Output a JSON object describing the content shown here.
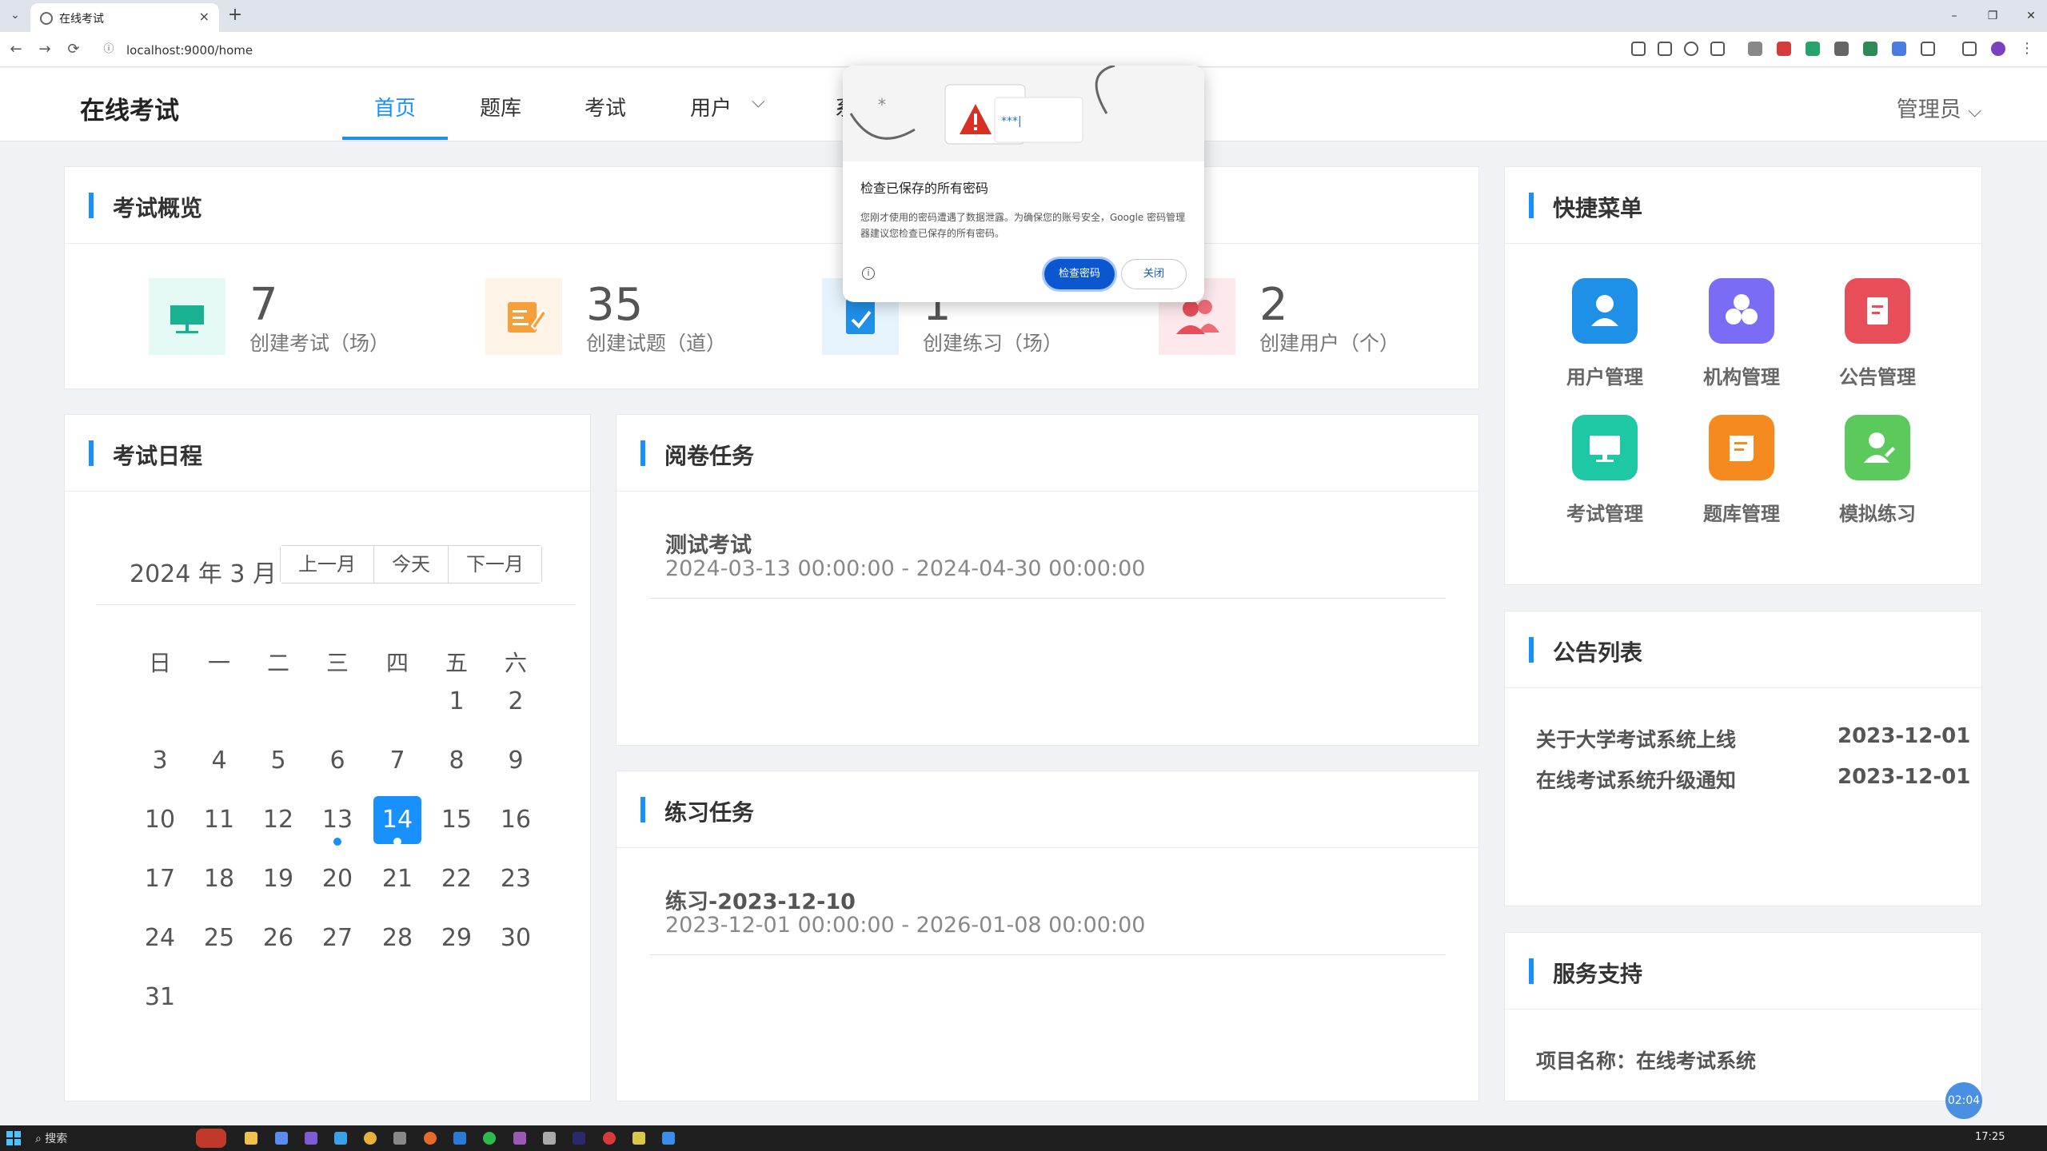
{
  "browser": {
    "tab_title": "在线考试",
    "tab_close": "×",
    "new_tab": "+",
    "url": "localhost:9000/home",
    "back": "←",
    "forward": "→",
    "reload": "⟳",
    "minimize": "–",
    "restore": "❐",
    "close": "✕"
  },
  "header": {
    "logo": "在线考试",
    "menu": [
      "首页",
      "题库",
      "考试",
      "用户",
      "系"
    ],
    "user_dropdown_caret": "⌵",
    "admin": "管理员"
  },
  "overview": {
    "title": "考试概览",
    "stats": [
      {
        "value": "7",
        "label": "创建考试（场）",
        "color": "#19b394",
        "bg": "#e6faf5"
      },
      {
        "value": "35",
        "label": "创建试题（道）",
        "color": "#f7a03b",
        "bg": "#fdf3e7"
      },
      {
        "value": "1",
        "label": "创建练习（场）",
        "color": "#1e90e8",
        "bg": "#e6f3fd"
      },
      {
        "value": "2",
        "label": "创建用户（个）",
        "color": "#e84d5a",
        "bg": "#fde9eb"
      }
    ]
  },
  "calendar": {
    "title": "考试日程",
    "month": "2024 年 3 月",
    "buttons": [
      "上一月",
      "今天",
      "下一月"
    ],
    "weekdays": [
      "日",
      "一",
      "二",
      "三",
      "四",
      "五",
      "六"
    ],
    "days": [
      "1",
      "2",
      "3",
      "4",
      "5",
      "6",
      "7",
      "8",
      "9",
      "10",
      "11",
      "12",
      "13",
      "14",
      "15",
      "16",
      "17",
      "18",
      "19",
      "20",
      "21",
      "22",
      "23",
      "24",
      "25",
      "26",
      "27",
      "28",
      "29",
      "30",
      "31"
    ],
    "first_weekday": 5,
    "today": 14,
    "event_days": [
      13,
      14
    ]
  },
  "review": {
    "title": "阅卷任务",
    "items": [
      {
        "name": "测试考试",
        "range": "2024-03-13 00:00:00 - 2024-04-30 00:00:00"
      }
    ]
  },
  "practice": {
    "title": "练习任务",
    "items": [
      {
        "name": "练习-2023-12-10",
        "range": "2023-12-01 00:00:00 - 2026-01-08 00:00:00"
      }
    ]
  },
  "quick_menu": {
    "title": "快捷菜单",
    "items": [
      {
        "label": "用户管理",
        "color": "#1e90e8",
        "icon": "user-icon"
      },
      {
        "label": "机构管理",
        "color": "#7b6cf6",
        "icon": "cubes-icon"
      },
      {
        "label": "公告管理",
        "color": "#e84d5a",
        "icon": "notice-icon"
      },
      {
        "label": "考试管理",
        "color": "#1ec8a5",
        "icon": "monitor-icon"
      },
      {
        "label": "题库管理",
        "color": "#f58a1f",
        "icon": "bank-icon"
      },
      {
        "label": "模拟练习",
        "color": "#5cc95c",
        "icon": "practice-icon"
      }
    ]
  },
  "notices": {
    "title": "公告列表",
    "items": [
      {
        "title": "关于大学考试系统上线",
        "date": "2023-12-01"
      },
      {
        "title": "在线考试系统升级通知",
        "date": "2023-12-01"
      }
    ]
  },
  "support": {
    "title": "服务支持",
    "project": "项目名称：在线考试系统"
  },
  "timer": "02:04",
  "password_popup": {
    "title": "检查已保存的所有密码",
    "body": "您刚才使用的密码遭遇了数据泄露。为确保您的账号安全，Google 密码管理器建议您检查已保存的所有密码。",
    "primary": "检查密码",
    "secondary": "关闭",
    "masked": "***|"
  },
  "taskbar": {
    "search": "搜索",
    "time": "17:25"
  }
}
